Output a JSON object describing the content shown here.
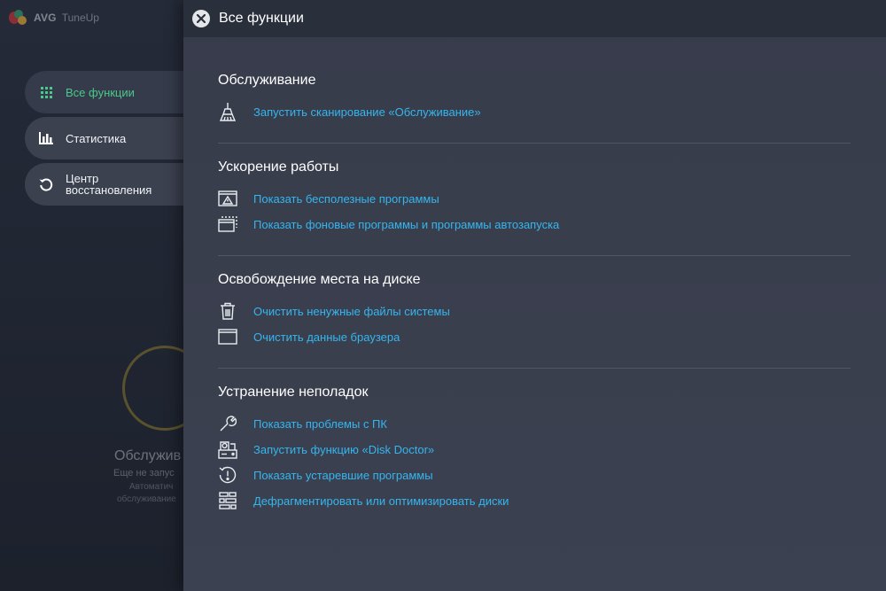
{
  "app": {
    "brand": "AVG",
    "product": "TuneUp"
  },
  "nav": {
    "items": [
      {
        "label": "Все функции",
        "icon": "grid-icon"
      },
      {
        "label": "Статистика",
        "icon": "bar-chart-icon"
      },
      {
        "label": "Центр\nвосстановления",
        "label_line1": "Центр",
        "label_line2": "восстановления",
        "icon": "restore-icon"
      }
    ]
  },
  "background_card": {
    "title": "Обслужив",
    "status": "Еще не запус",
    "desc1": "Автоматич",
    "desc2": "обслуживание"
  },
  "panel": {
    "title": "Все функции",
    "sections": [
      {
        "title": "Обслуживание",
        "actions": [
          {
            "label": "Запустить сканирование «Обслуживание»",
            "icon": "broom-icon"
          }
        ]
      },
      {
        "title": "Ускорение работы",
        "actions": [
          {
            "label": "Показать бесполезные программы",
            "icon": "warning-window-icon"
          },
          {
            "label": "Показать фоновые программы и программы автозапуска",
            "icon": "background-window-icon"
          }
        ]
      },
      {
        "title": "Освобождение места на диске",
        "actions": [
          {
            "label": "Очистить ненужные файлы системы",
            "icon": "trash-icon"
          },
          {
            "label": "Очистить данные браузера",
            "icon": "browser-window-icon"
          }
        ]
      },
      {
        "title": "Устранение неполадок",
        "actions": [
          {
            "label": "Показать проблемы с ПК",
            "icon": "wrench-icon"
          },
          {
            "label": "Запустить функцию «Disk Doctor»",
            "icon": "disk-doctor-icon"
          },
          {
            "label": "Показать устаревшие программы",
            "icon": "outdated-clock-icon"
          },
          {
            "label": "Дефрагментировать или оптимизировать диски",
            "icon": "defrag-icon"
          }
        ]
      }
    ]
  },
  "colors": {
    "link": "#35b6ef",
    "active_nav": "#49c98a"
  }
}
